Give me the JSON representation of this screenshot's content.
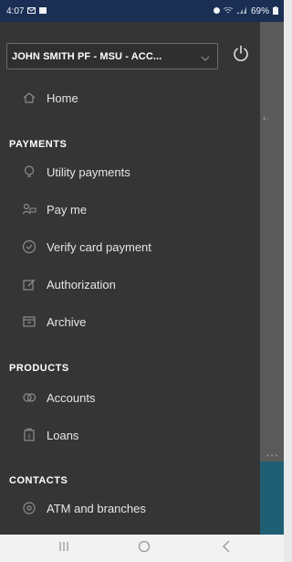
{
  "status_bar": {
    "time": "4:07",
    "left_icons": [
      "mail-icon",
      "image-icon"
    ],
    "right_text": "69%",
    "right_icons": [
      "alarm-icon",
      "wifi-icon",
      "signal-icon",
      "battery-icon"
    ]
  },
  "drawer": {
    "account_selector": {
      "value": "JOHN SMITH PF - MSU - ACC..."
    },
    "home": {
      "label": "Home",
      "icon": "home-icon"
    },
    "sections": [
      {
        "header": "PAYMENTS",
        "items": [
          {
            "label": "Utility payments",
            "icon": "lightbulb-icon"
          },
          {
            "label": "Pay me",
            "icon": "person-money-icon"
          },
          {
            "label": "Verify card payment",
            "icon": "check-circle-icon"
          },
          {
            "label": "Authorization",
            "icon": "edit-icon"
          },
          {
            "label": "Archive",
            "icon": "archive-icon"
          }
        ]
      },
      {
        "header": "PRODUCTS",
        "items": [
          {
            "label": "Accounts",
            "icon": "coins-icon"
          },
          {
            "label": "Loans",
            "icon": "loan-icon"
          }
        ]
      },
      {
        "header": "CONTACTS",
        "items": [
          {
            "label": "ATM and branches",
            "icon": "location-icon"
          }
        ]
      }
    ]
  },
  "nav_bar": {
    "buttons": [
      "recent-apps-icon",
      "home-circle-icon",
      "back-icon"
    ]
  },
  "colors": {
    "status_bar": "#1b2f54",
    "drawer": "#353535",
    "text": "#e6e6e6",
    "icon": "#8d8d8d",
    "nav_bar": "#f2f2f2"
  }
}
